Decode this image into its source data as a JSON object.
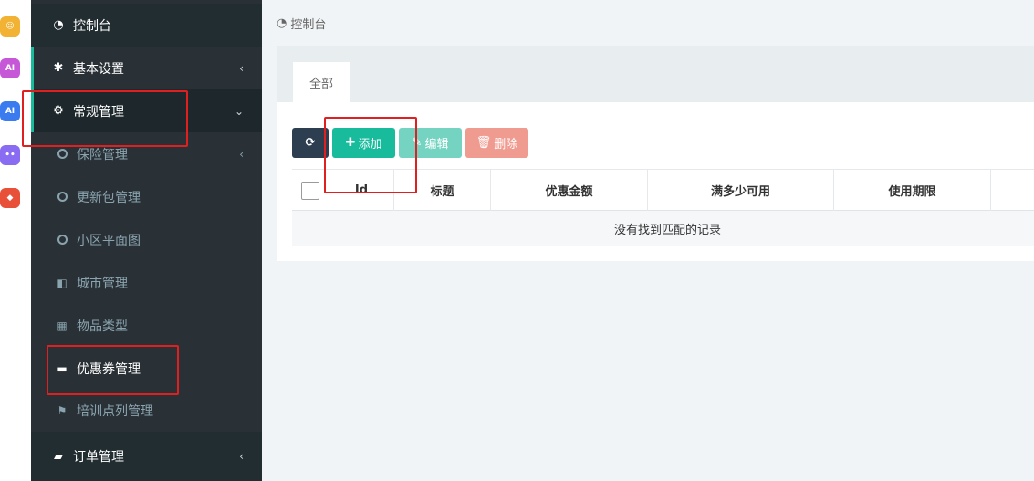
{
  "app_icons": [
    {
      "name": "bot-app-icon",
      "color": "#f2b233",
      "glyph": "☺"
    },
    {
      "name": "ai-app-icon-1",
      "color": "#c658d8",
      "glyph": "AI"
    },
    {
      "name": "ai-app-icon-2",
      "color": "#3a7bf0",
      "glyph": "AI"
    },
    {
      "name": "chat-app-icon",
      "color": "#8a6cf2",
      "glyph": "••"
    },
    {
      "name": "game-app-icon",
      "color": "#e8503a",
      "glyph": "◆"
    }
  ],
  "sidebar": {
    "dashboard": {
      "label": "控制台",
      "icon": "dashboard-icon"
    },
    "basic_settings": {
      "label": "基本设置",
      "icon": "gear-icon"
    },
    "general_management": {
      "label": "常规管理",
      "icon": "cogs-icon"
    },
    "sub_items": [
      {
        "label": "保险管理",
        "icon": "circle-icon"
      },
      {
        "label": "更新包管理",
        "icon": "circle-icon"
      },
      {
        "label": "小区平面图",
        "icon": "circle-icon"
      },
      {
        "label": "城市管理",
        "icon": "columns-icon"
      },
      {
        "label": "物品类型",
        "icon": "grid-icon"
      },
      {
        "label": "优惠券管理",
        "icon": "card-icon"
      },
      {
        "label": "培训点列管理",
        "icon": "flag-icon"
      }
    ],
    "orders": {
      "label": "订单管理",
      "icon": "book-icon"
    }
  },
  "breadcrumb": {
    "label": "控制台"
  },
  "tabs": [
    {
      "label": "全部"
    }
  ],
  "toolbar": {
    "add_label": "添加",
    "edit_label": "编辑",
    "delete_label": "删除"
  },
  "table": {
    "columns": [
      "Id",
      "标题",
      "优惠金额",
      "满多少可用",
      "使用期限"
    ],
    "empty_text": "没有找到匹配的记录"
  },
  "colors": {
    "sidebar_bg": "#2a3136",
    "accent": "#18bc9c",
    "primary_dark": "#2c3e50",
    "danger": "#f09b90"
  }
}
